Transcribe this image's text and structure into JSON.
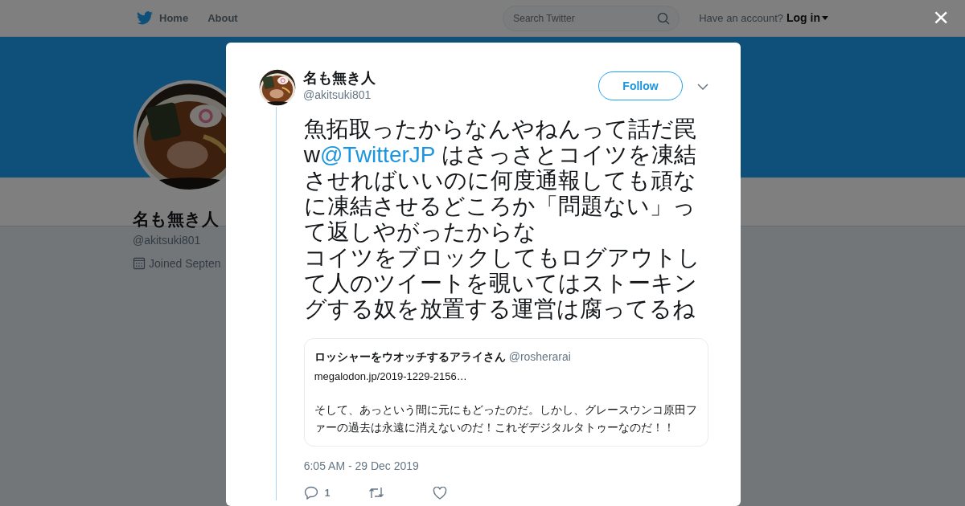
{
  "navbar": {
    "links": [
      {
        "label": "Home",
        "kind": "home"
      },
      {
        "label": "About",
        "kind": "plain"
      }
    ],
    "search": {
      "placeholder": "Search Twitter"
    },
    "account_prompt": "Have an account?",
    "login": "Log in"
  },
  "profile": {
    "name": "名も無き人",
    "handle": "@akitsuki801",
    "joined": "Joined Septen"
  },
  "close": "×",
  "tweet": {
    "name": "名も無き人",
    "handle": "@akitsuki801",
    "follow": "Follow",
    "text_before": "魚拓取ったからなんやねんって話だ罠w",
    "mention": "@TwitterJP",
    "text_after": " はさっさとコイツを凍結させればいいのに何度通報しても頑なに凍結させるどころか「問題ない」って返しやがったからな",
    "text_last": "コイツをブロックしてもログアウトして人のツイートを覗いてはストーキングする奴を放置する運営は腐ってるね",
    "quote": {
      "name": "ロッシャーをウオッチするアライさん",
      "handle": "@rosherarai",
      "link": "megalodon.jp/2019-1229-2156…",
      "text": "そして、あっという間に元にもどったのだ。しかし、グレースウンコ原田ファーの過去は永遠に消えないのだ！これぞデジタルタトゥーなのだ！！"
    },
    "time": "6:05 AM - 29 Dec 2019",
    "actions": [
      {
        "kind": "reply",
        "count": "1"
      },
      {
        "kind": "retweet"
      },
      {
        "kind": "like"
      }
    ]
  }
}
